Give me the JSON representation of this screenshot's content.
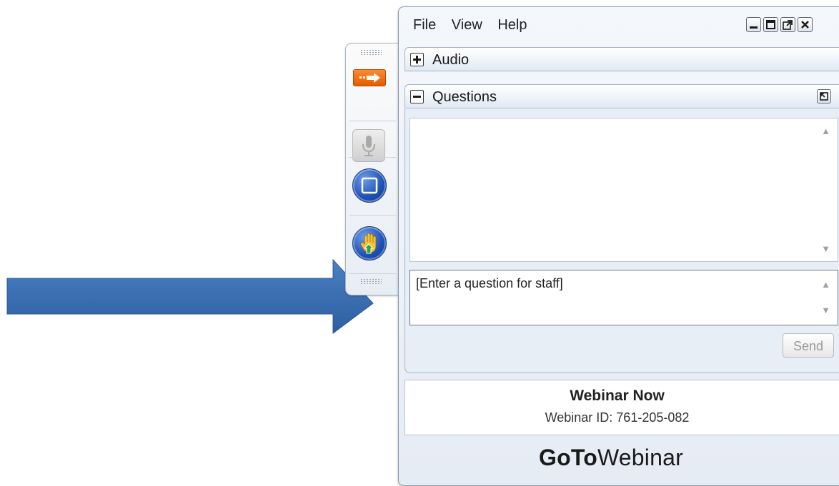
{
  "menu": {
    "file": "File",
    "view": "View",
    "help": "Help"
  },
  "sections": {
    "audio": "Audio",
    "questions": "Questions"
  },
  "question_input": {
    "placeholder": "[Enter a question for staff]"
  },
  "send_label": "Send",
  "webinar": {
    "title": "Webinar Now",
    "id_text": "Webinar ID: 761-205-082"
  },
  "brand": {
    "bold": "GoTo",
    "regular": "Webinar"
  },
  "icons": {
    "collapse": "arrow-right-icon",
    "mic": "microphone-icon",
    "screen": "screen-icon",
    "hand": "raise-hand-icon",
    "annotation": "arrow-icon"
  },
  "colors": {
    "annotation_arrow": "#3a6fb2",
    "collapse_button": "#f07a1a",
    "round_button": "#1d4fb5"
  }
}
